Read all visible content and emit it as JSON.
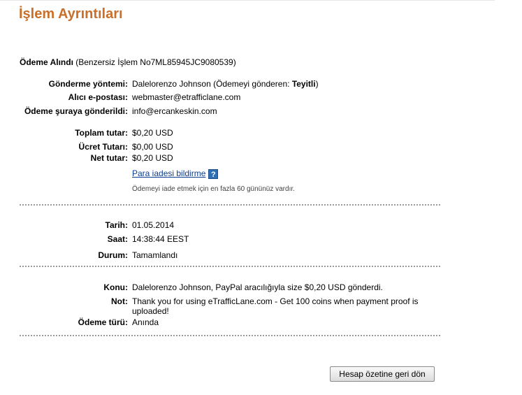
{
  "page": {
    "title": "İşlem Ayrıntıları"
  },
  "status": {
    "label": "Ödeme Alındı",
    "detail": "(Benzersiz İşlem No7ML85945JC9080539)"
  },
  "sender_section": {
    "method_label": "Gönderme yöntemi:",
    "method_value": "Dalelorenzo Johnson (Ödemeyi gönderen: ",
    "method_verified": "Teyitli",
    "method_close": ")",
    "recipient_label": "Alıcı e-postası:",
    "recipient_value": "webmaster@etrafficlane.com",
    "sent_to_label": "Ödeme şuraya gönderildi:",
    "sent_to_value": "info@ercankeskin.com"
  },
  "amounts": {
    "total_label": "Toplam tutar:",
    "total_value": "$0,20 USD",
    "fee_label": "Ücret Tutarı:",
    "fee_value": "$0,00 USD",
    "net_label": "Net tutar:",
    "net_value": "$0,20 USD",
    "refund_link": "Para iadesi bildirme",
    "help_icon": "question-icon",
    "help_glyph": "?",
    "refund_note": "Ödemeyi iade etmek için en fazla 60 gününüz vardır."
  },
  "datetime": {
    "date_label": "Tarih:",
    "date_value": "01.05.2014",
    "time_label": "Saat:",
    "time_value": "14:38:44 EEST",
    "state_label": "Durum:",
    "state_value": "Tamamlandı"
  },
  "details": {
    "subject_label": "Konu:",
    "subject_value": "Dalelorenzo Johnson, PayPal aracılığıyla size $0,20 USD gönderdi.",
    "note_label": "Not:",
    "note_value": "Thank you for using eTrafficLane.com - Get 100 coins when payment proof is uploaded!",
    "type_label": "Ödeme türü:",
    "type_value": "Anında"
  },
  "footer": {
    "back_button": "Hesap özetine geri dön"
  },
  "colors": {
    "title": "#c96f2a",
    "link": "#0b3d91",
    "help_icon": "#2f6fb6"
  }
}
